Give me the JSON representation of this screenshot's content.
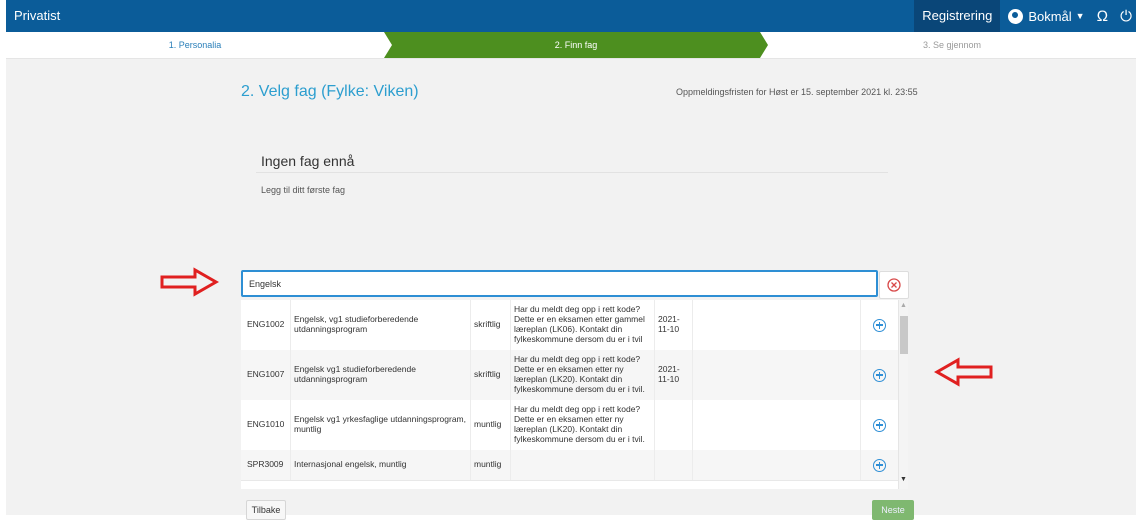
{
  "topbar": {
    "brand": "Privatist",
    "registrering": "Registrering",
    "language": "Bokmål"
  },
  "steps": [
    {
      "label": "1. Personalia"
    },
    {
      "label": "2. Finn fag"
    },
    {
      "label": "3. Se gjennom"
    }
  ],
  "page": {
    "title": "2. Velg fag (Fylke: Viken)",
    "deadline": "Oppmeldingsfristen for Høst er 15. september 2021 kl. 23:55",
    "empty_title": "Ingen fag ennå",
    "empty_subtitle": "Legg til ditt første fag"
  },
  "search": {
    "value": "Engelsk"
  },
  "results": [
    {
      "code": "ENG1002",
      "name": "Engelsk, vg1 studieforberedende utdanningsprogram",
      "type": "skriftlig",
      "info": "Har du meldt deg opp i rett kode? Dette er en eksamen etter gammel læreplan (LK06). Kontakt din fylkeskommune dersom du er i tvil",
      "date": "2021-11-10"
    },
    {
      "code": "ENG1007",
      "name": "Engelsk vg1 studieforberedende utdanningsprogram",
      "type": "skriftlig",
      "info": "Har du meldt deg opp i rett kode? Dette er en eksamen etter ny læreplan (LK20). Kontakt din fylkeskommune dersom du er i tvil.",
      "date": "2021-11-10"
    },
    {
      "code": "ENG1010",
      "name": "Engelsk vg1 yrkesfaglige utdanningsprogram, muntlig",
      "type": "muntlig",
      "info": "Har du meldt deg opp i rett kode? Dette er en eksamen etter ny læreplan (LK20). Kontakt din fylkeskommune dersom du er i tvil.",
      "date": ""
    },
    {
      "code": "SPR3009",
      "name": "Internasjonal engelsk, muntlig",
      "type": "muntlig",
      "info": "",
      "date": ""
    }
  ],
  "buttons": {
    "back": "Tilbake",
    "next": "Neste"
  },
  "colors": {
    "topbar": "#0b5c99",
    "active_step": "#4d8f1f",
    "accent": "#2c9ecf",
    "annotation_arrow": "#e02020"
  }
}
